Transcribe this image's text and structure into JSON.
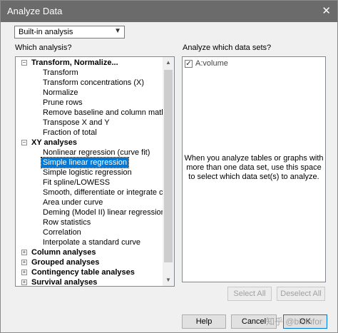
{
  "window": {
    "title": "Analyze Data",
    "close_glyph": "✕"
  },
  "analysis_type": {
    "selected": "Built-in analysis"
  },
  "labels": {
    "which_analysis": "Which analysis?",
    "which_datasets": "Analyze which data sets?"
  },
  "tree": {
    "categories": [
      {
        "label": "Transform, Normalize...",
        "expanded": true,
        "items": [
          "Transform",
          "Transform concentrations (X)",
          "Normalize",
          "Prune rows",
          "Remove baseline and column math",
          "Transpose X and Y",
          "Fraction of total"
        ]
      },
      {
        "label": "XY analyses",
        "expanded": true,
        "items": [
          "Nonlinear regression (curve fit)",
          "Simple linear regression",
          "Simple logistic regression",
          "Fit spline/LOWESS",
          "Smooth, differentiate or integrate curve",
          "Area under curve",
          "Deming (Model II) linear regression",
          "Row statistics",
          "Correlation",
          "Interpolate a standard curve"
        ]
      },
      {
        "label": "Column analyses",
        "expanded": false
      },
      {
        "label": "Grouped analyses",
        "expanded": false
      },
      {
        "label": "Contingency table analyses",
        "expanded": false
      },
      {
        "label": "Survival analyses",
        "expanded": false
      }
    ],
    "selected_item": "Simple linear regression"
  },
  "datasets": {
    "items": [
      {
        "label": "A:volume",
        "checked": true
      }
    ],
    "note": "When you analyze tables or graphs with more than one data set, use this space to select which data set(s) to analyze."
  },
  "buttons": {
    "select_all": "Select All",
    "deselect_all": "Deselect All",
    "help": "Help",
    "cancel": "Cancel",
    "ok": "OK"
  },
  "watermark": "知乎 @bioinfor"
}
